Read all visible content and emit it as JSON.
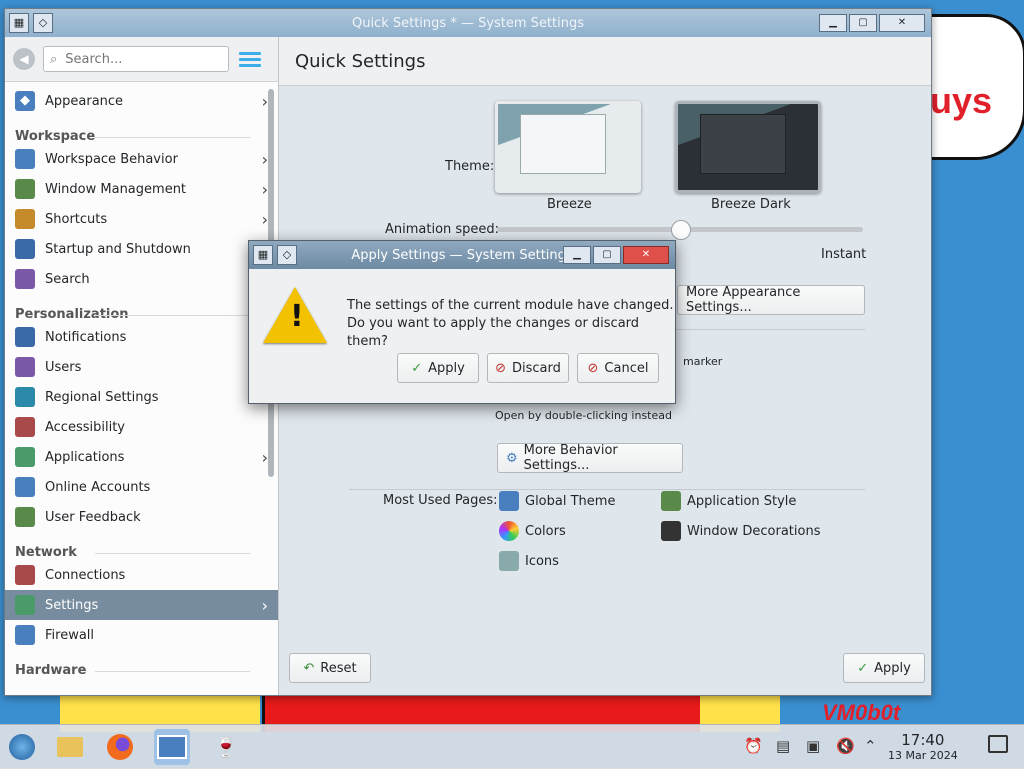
{
  "wallpaper": {
    "cloud_text": "uys",
    "watermark": "VM0b0t"
  },
  "main_window": {
    "title": "Quick Settings * — System Settings",
    "buttons": {
      "minimize": "▁",
      "maximize": "▢",
      "close": "✕"
    }
  },
  "sidebar": {
    "search_placeholder": "Search...",
    "top_item": {
      "label": "Appearance",
      "icon": "appearance-icon"
    },
    "sections": [
      {
        "title": "Workspace",
        "items": [
          {
            "label": "Workspace Behavior",
            "icon": "workspace-icon",
            "chevron": true
          },
          {
            "label": "Window Management",
            "icon": "window-icon",
            "chevron": true
          },
          {
            "label": "Shortcuts",
            "icon": "keyboard-icon",
            "chevron": true
          },
          {
            "label": "Startup and Shutdown",
            "icon": "power-icon",
            "chevron": true
          },
          {
            "label": "Search",
            "icon": "search-icon",
            "chevron": true
          }
        ]
      },
      {
        "title": "Personalization",
        "items": [
          {
            "label": "Notifications",
            "icon": "bell-icon",
            "chevron": false
          },
          {
            "label": "Users",
            "icon": "users-icon",
            "chevron": false
          },
          {
            "label": "Regional Settings",
            "icon": "globe-icon",
            "chevron": true
          },
          {
            "label": "Accessibility",
            "icon": "accessibility-icon",
            "chevron": false
          },
          {
            "label": "Applications",
            "icon": "applications-icon",
            "chevron": true
          },
          {
            "label": "Online Accounts",
            "icon": "online-accounts-icon",
            "chevron": false
          },
          {
            "label": "User Feedback",
            "icon": "feedback-icon",
            "chevron": false
          }
        ]
      },
      {
        "title": "Network",
        "items": [
          {
            "label": "Connections",
            "icon": "network-icon",
            "chevron": false
          },
          {
            "label": "Settings",
            "icon": "network-settings-icon",
            "chevron": true,
            "selected": true
          },
          {
            "label": "Firewall",
            "icon": "firewall-icon",
            "chevron": false
          }
        ]
      },
      {
        "title": "Hardware",
        "items": []
      }
    ]
  },
  "content": {
    "header": "Quick Settings",
    "theme_label": "Theme:",
    "themes": [
      "Breeze",
      "Breeze Dark"
    ],
    "animation_label": "Animation speed:",
    "animation_end_label": "Instant",
    "animation_value": 0.5,
    "more_appearance": "More Appearance Settings...",
    "marker_text": "marker",
    "double_click_text": "Open by double-clicking instead",
    "more_behavior": "More Behavior Settings...",
    "most_used_label": "Most Used Pages:",
    "most_used": [
      {
        "label": "Global Theme",
        "icon": "global-theme-icon"
      },
      {
        "label": "Application Style",
        "icon": "application-style-icon"
      },
      {
        "label": "Colors",
        "icon": "colors-icon"
      },
      {
        "label": "Window Decorations",
        "icon": "window-decorations-icon"
      },
      {
        "label": "Icons",
        "icon": "icons-icon"
      }
    ],
    "reset": "Reset",
    "apply": "Apply"
  },
  "dialog": {
    "title": "Apply Settings — System Settings",
    "message_line1": "The settings of the current module have changed.",
    "message_line2": "Do you want to apply the changes or discard them?",
    "apply": "Apply",
    "discard": "Discard",
    "cancel": "Cancel"
  },
  "taskbar": {
    "time": "17:40",
    "date": "13 Mar 2024"
  },
  "colors": {
    "accent": "#3daee9",
    "selection": "#778c9e"
  }
}
